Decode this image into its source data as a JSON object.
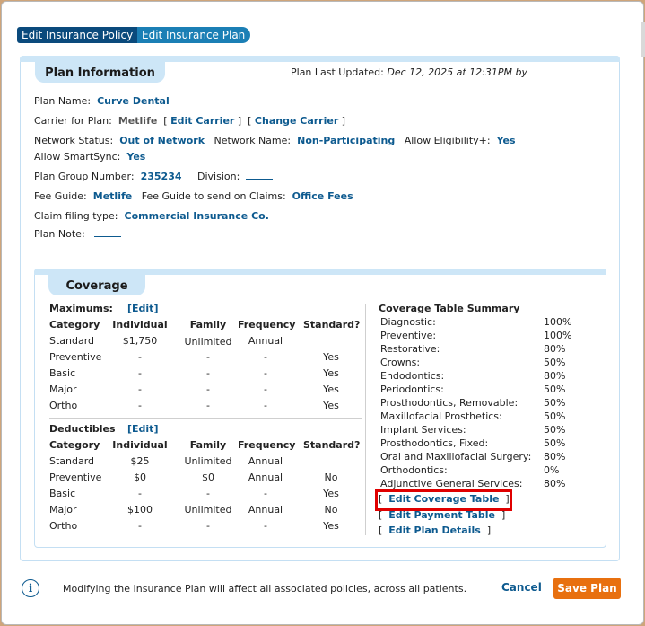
{
  "tabs": [
    "Edit Insurance Policy",
    "Edit Insurance Plan"
  ],
  "plan_info": {
    "title": "Plan Information",
    "last_updated_label": "Plan Last Updated:",
    "last_updated_value": "Dec 12, 2025 at 12:31PM by",
    "plan_name_label": "Plan Name:",
    "plan_name": "Curve Dental",
    "carrier_label": "Carrier for Plan:",
    "carrier": "Metlife",
    "edit_carrier": "Edit Carrier",
    "change_carrier": "Change Carrier",
    "network_status_label": "Network Status:",
    "network_status": "Out of Network",
    "network_name_label": "Network Name:",
    "network_name": "Non-Participating",
    "allow_eligibility_label": "Allow Eligibility+:",
    "allow_eligibility": "Yes",
    "allow_smartsync_label": "Allow SmartSync:",
    "allow_smartsync": "Yes",
    "group_number_label": "Plan Group Number:",
    "group_number": "235234",
    "division_label": "Division:",
    "fee_guide_label": "Fee Guide:",
    "fee_guide": "Metlife",
    "fee_guide_claims_label": "Fee Guide to send on Claims:",
    "fee_guide_claims": "Office Fees",
    "claim_type_label": "Claim filing type:",
    "claim_type": "Commercial Insurance Co.",
    "plan_note_label": "Plan Note:"
  },
  "coverage": {
    "title": "Coverage",
    "maximums": {
      "title": "Maximums:",
      "edit": "[Edit]",
      "headers": [
        "Category",
        "Individual",
        "Family",
        "Frequency",
        "Standard?"
      ],
      "rows": [
        [
          "Standard",
          "$1,750",
          "Unlimited",
          "Annual",
          ""
        ],
        [
          "Preventive",
          "-",
          "-",
          "-",
          "Yes"
        ],
        [
          "Basic",
          "-",
          "-",
          "-",
          "Yes"
        ],
        [
          "Major",
          "-",
          "-",
          "-",
          "Yes"
        ],
        [
          "Ortho",
          "-",
          "-",
          "-",
          "Yes"
        ]
      ]
    },
    "deductibles": {
      "title": "Deductibles",
      "edit": "[Edit]",
      "headers": [
        "Category",
        "Individual",
        "Family",
        "Frequency",
        "Standard?"
      ],
      "rows": [
        [
          "Standard",
          "$25",
          "Unlimited",
          "Annual",
          ""
        ],
        [
          "Preventive",
          "$0",
          "$0",
          "Annual",
          "No"
        ],
        [
          "Basic",
          "-",
          "-",
          "-",
          "Yes"
        ],
        [
          "Major",
          "$100",
          "Unlimited",
          "Annual",
          "No"
        ],
        [
          "Ortho",
          "-",
          "-",
          "-",
          "Yes"
        ]
      ]
    },
    "summary": {
      "title": "Coverage Table Summary",
      "rows": [
        [
          "Diagnostic:",
          "100%"
        ],
        [
          "Preventive:",
          "100%"
        ],
        [
          "Restorative:",
          "80%"
        ],
        [
          "Crowns:",
          "50%"
        ],
        [
          "Endodontics:",
          "80%"
        ],
        [
          "Periodontics:",
          "50%"
        ],
        [
          "Prosthodontics, Removable:",
          "50%"
        ],
        [
          "Maxillofacial Prosthetics:",
          "50%"
        ],
        [
          "Implant Services:",
          "50%"
        ],
        [
          "Prosthodontics, Fixed:",
          "50%"
        ],
        [
          "Oral and Maxillofacial Surgery:",
          "80%"
        ],
        [
          "Orthodontics:",
          "0%"
        ],
        [
          "Adjunctive General Services:",
          "80%"
        ]
      ],
      "links": [
        "Edit Coverage Table",
        "Edit Payment Table",
        "Edit Plan Details"
      ]
    }
  },
  "footer": {
    "message": "Modifying the Insurance Plan will affect all associated policies, across all patients.",
    "cancel": "Cancel",
    "save": "Save Plan"
  },
  "colors": {
    "accent": "#0d5a8f",
    "tab_dark": "#0a4a7c",
    "tab_light": "#1b7fb5",
    "save": "#e8700f",
    "highlight": "#e00000"
  }
}
